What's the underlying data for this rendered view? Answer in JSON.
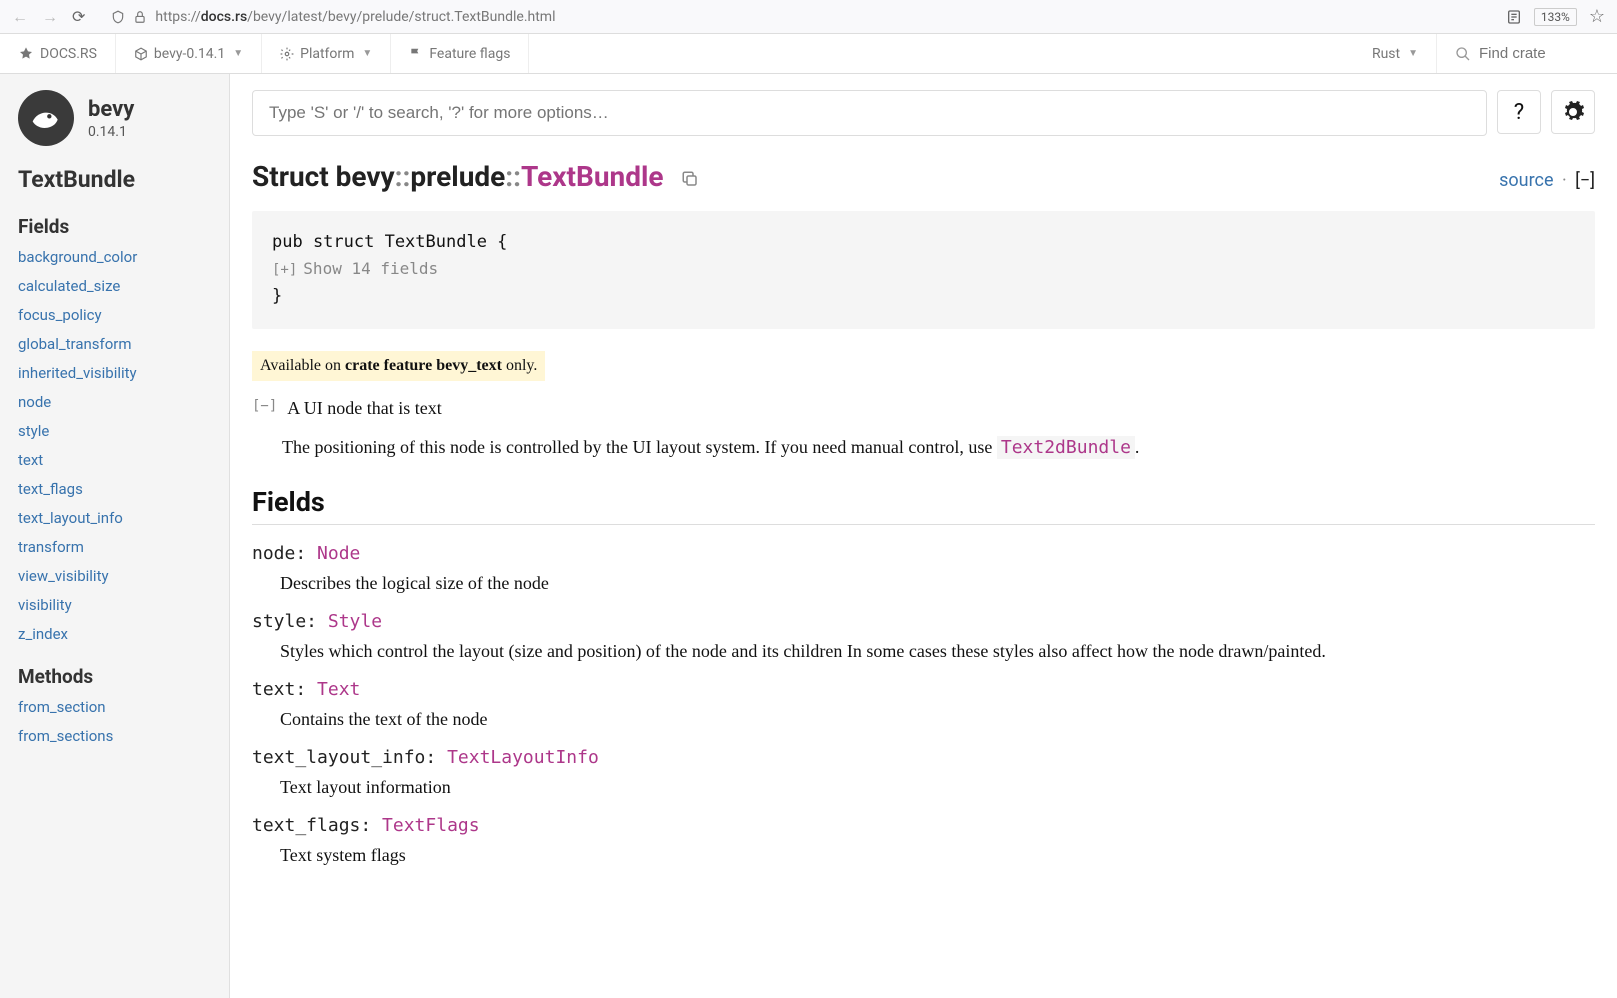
{
  "browser": {
    "url_prefix": "https://",
    "url_host": "docs.rs",
    "url_path": "/bevy/latest/bevy/prelude/struct.TextBundle.html",
    "zoom": "133%"
  },
  "docsrs": {
    "brand": "DOCS.RS",
    "crate": "bevy-0.14.1",
    "platform": "Platform",
    "flags": "Feature flags",
    "lang": "Rust",
    "search_placeholder": "Find crate"
  },
  "sidebar": {
    "crate_name": "bevy",
    "crate_version": "0.14.1",
    "page_item": "TextBundle",
    "fields_heading": "Fields",
    "fields": [
      "background_color",
      "calculated_size",
      "focus_policy",
      "global_transform",
      "inherited_visibility",
      "node",
      "style",
      "text",
      "text_flags",
      "text_layout_info",
      "transform",
      "view_visibility",
      "visibility",
      "z_index"
    ],
    "methods_heading": "Methods",
    "methods": [
      "from_section",
      "from_sections"
    ]
  },
  "content": {
    "search_placeholder": "Type 'S' or '/' to search, '?' for more options…",
    "help_label": "?",
    "title_kind": "Struct ",
    "title_path1": "bevy",
    "title_path2": "prelude",
    "title_name": "TextBundle",
    "source_label": "source",
    "collapse_label": "[−]",
    "code_line1": "pub struct TextBundle {",
    "show_fields_toggle": "[+]",
    "show_fields": "Show 14 fields",
    "code_line3": "}",
    "feature_prefix": "Available on ",
    "feature_bold": "crate feature ",
    "feature_name": "bevy_text",
    "feature_suffix": " only.",
    "desc_toggle": "[−]",
    "desc1": "A UI node that is text",
    "desc2a": "The positioning of this node is controlled by the UI layout system. If you need manual control, use ",
    "desc2_link": "Text2dBundle",
    "desc2b": ".",
    "fields_h": "Fields",
    "fields": [
      {
        "name": "node",
        "type": "Node",
        "desc": "Describes the logical size of the node"
      },
      {
        "name": "style",
        "type": "Style",
        "desc": "Styles which control the layout (size and position) of the node and its children In some cases these styles also affect how the node drawn/painted."
      },
      {
        "name": "text",
        "type": "Text",
        "desc": "Contains the text of the node"
      },
      {
        "name": "text_layout_info",
        "type": "TextLayoutInfo",
        "desc": "Text layout information"
      },
      {
        "name": "text_flags",
        "type": "TextFlags",
        "desc": "Text system flags"
      }
    ]
  }
}
